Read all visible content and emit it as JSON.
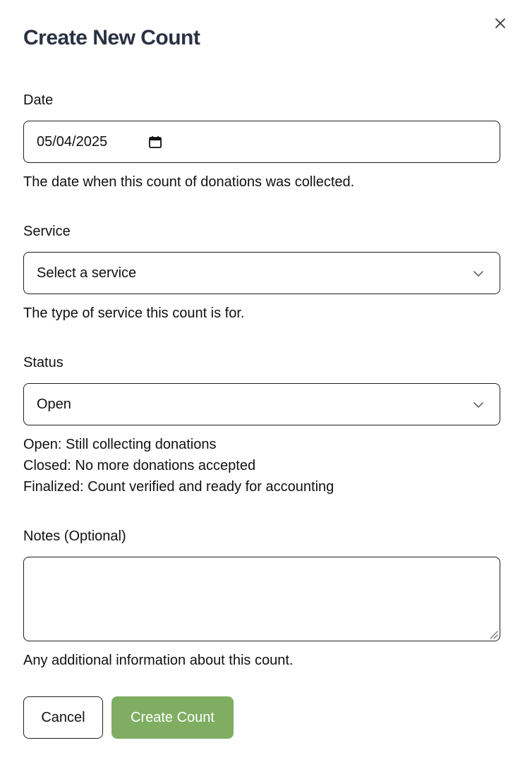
{
  "dialog": {
    "title": "Create New Count",
    "close_icon": "close-icon"
  },
  "date": {
    "label": "Date",
    "value": "05/04/2025",
    "icon": "calendar-icon",
    "help": "The date when this count of donations was collected."
  },
  "service": {
    "label": "Service",
    "value": "Select a service",
    "icon": "chevron-down-icon",
    "help": "The type of service this count is for."
  },
  "status": {
    "label": "Status",
    "value": "Open",
    "icon": "chevron-down-icon",
    "help_lines": [
      "Open: Still collecting donations",
      "Closed: No more donations accepted",
      "Finalized: Count verified and ready for accounting"
    ]
  },
  "notes": {
    "label": "Notes (Optional)",
    "value": "",
    "help": "Any additional information about this count."
  },
  "actions": {
    "cancel_label": "Cancel",
    "create_label": "Create Count",
    "create_color": "#7fae63"
  }
}
